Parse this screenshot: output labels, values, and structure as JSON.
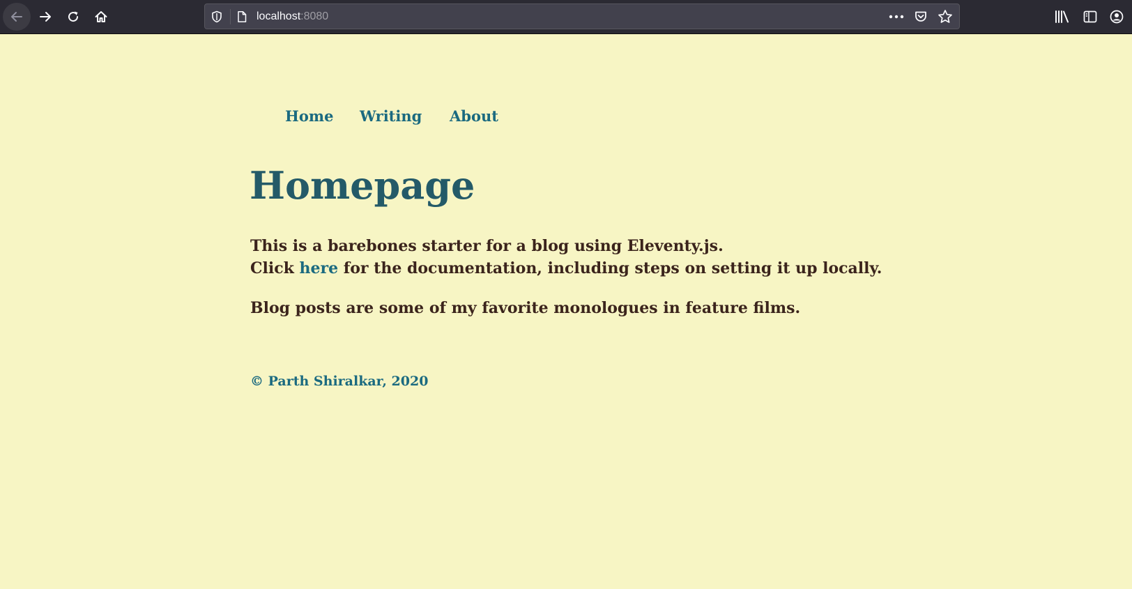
{
  "browser": {
    "url_host": "localhost",
    "url_port": ":8080",
    "icons": [
      "back-icon",
      "forward-icon",
      "reload-icon",
      "home-icon",
      "shield-icon",
      "page-icon",
      "more-icon",
      "pocket-icon",
      "bookmark-star-icon",
      "library-icon",
      "sidebar-icon",
      "account-icon"
    ]
  },
  "nav": {
    "items": [
      {
        "label": "Home"
      },
      {
        "label": "Writing"
      },
      {
        "label": "About"
      }
    ]
  },
  "main": {
    "title": "Homepage",
    "intro_line1": "This is a barebones starter for a blog using Eleventy.js.",
    "intro_line2_before": "Click ",
    "intro_line2_link": "here",
    "intro_line2_after": " for the documentation, including steps on setting it up locally.",
    "posts_note": "Blog posts are some of my favorite monologues in feature films."
  },
  "footer": {
    "copyright": "© Parth Shiralkar, 2020"
  },
  "colors": {
    "page_background": "#f7f5c4",
    "link": "#1b6a80",
    "heading": "#245a68",
    "body_text": "#3b241c",
    "chrome_background": "#2b2a33"
  }
}
